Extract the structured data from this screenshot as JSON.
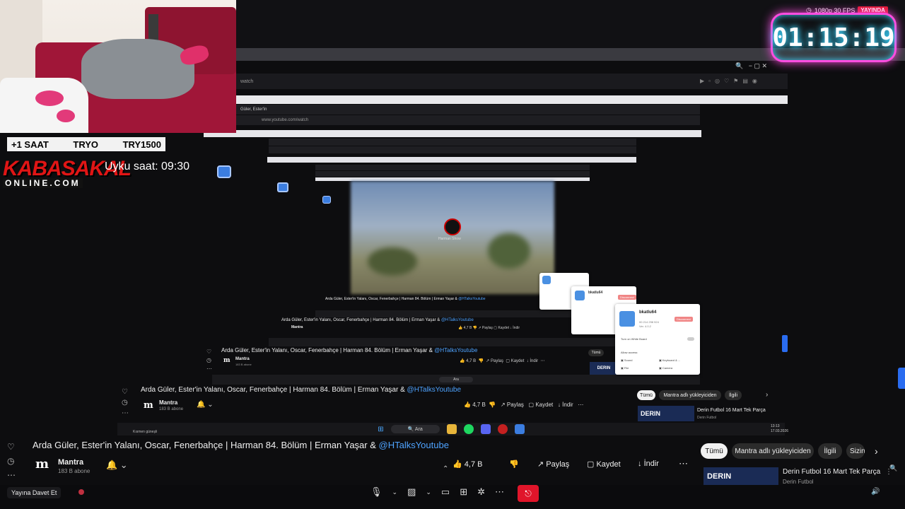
{
  "overlay": {
    "donation_items": [
      "+1 SAAT",
      "TRYO",
      "TRY1500"
    ],
    "logo_main": "KABASAKAL",
    "logo_sub": "ONLINE.COM",
    "sleep_label": "Uyku saat: 09:30",
    "timer": "01:15:19",
    "quality": "1080p 30 FPS",
    "live_badge": "YAYINDA"
  },
  "nested_browser": {
    "url_outer": "watch",
    "tab_title": "Güler, Ester'in",
    "url_inner": "www.youtube.com/watch",
    "video_overlay": "Harman Show"
  },
  "video": {
    "title": "Arda Güler, Ester'in Yalanı, Oscar, Fenerbahçe | Harman 84. Bölüm | Erman Yaşar & ",
    "title_tag": "@HTalksYoutube",
    "channel": "Mantra",
    "subscribers": "183 B abone",
    "likes": "4,7 B",
    "share": "Paylaş",
    "save": "Kaydet",
    "download": "İndir"
  },
  "filters": [
    "Tümü",
    "Mantra adlı yükleyiciden",
    "İlgili",
    "Sizin"
  ],
  "related": {
    "title": "Derin Futbol 16 Mart Tek Parça",
    "channel": "Derin Futbol",
    "thumb_label": "DERIN"
  },
  "popup": {
    "name": "bkatlu64",
    "id": "00 214 298 924",
    "version": "Ver. 4.0.2",
    "button": "Disconnect",
    "toggle_label": "Turn on White Board",
    "allow_label": "Allow access:",
    "options": [
      "Sound",
      "Keyboard & ...",
      "File",
      "Camera"
    ]
  },
  "bottom": {
    "invite": "Yayına Davet Et",
    "search": "Ara",
    "clock_time": "13:13",
    "clock_date": "17.03.2026",
    "weather": "Kısmen güneşli"
  },
  "colors": {
    "accent_red": "#e0152a",
    "timer_glow": "#ff4de0",
    "link_blue": "#4ea3ff"
  }
}
